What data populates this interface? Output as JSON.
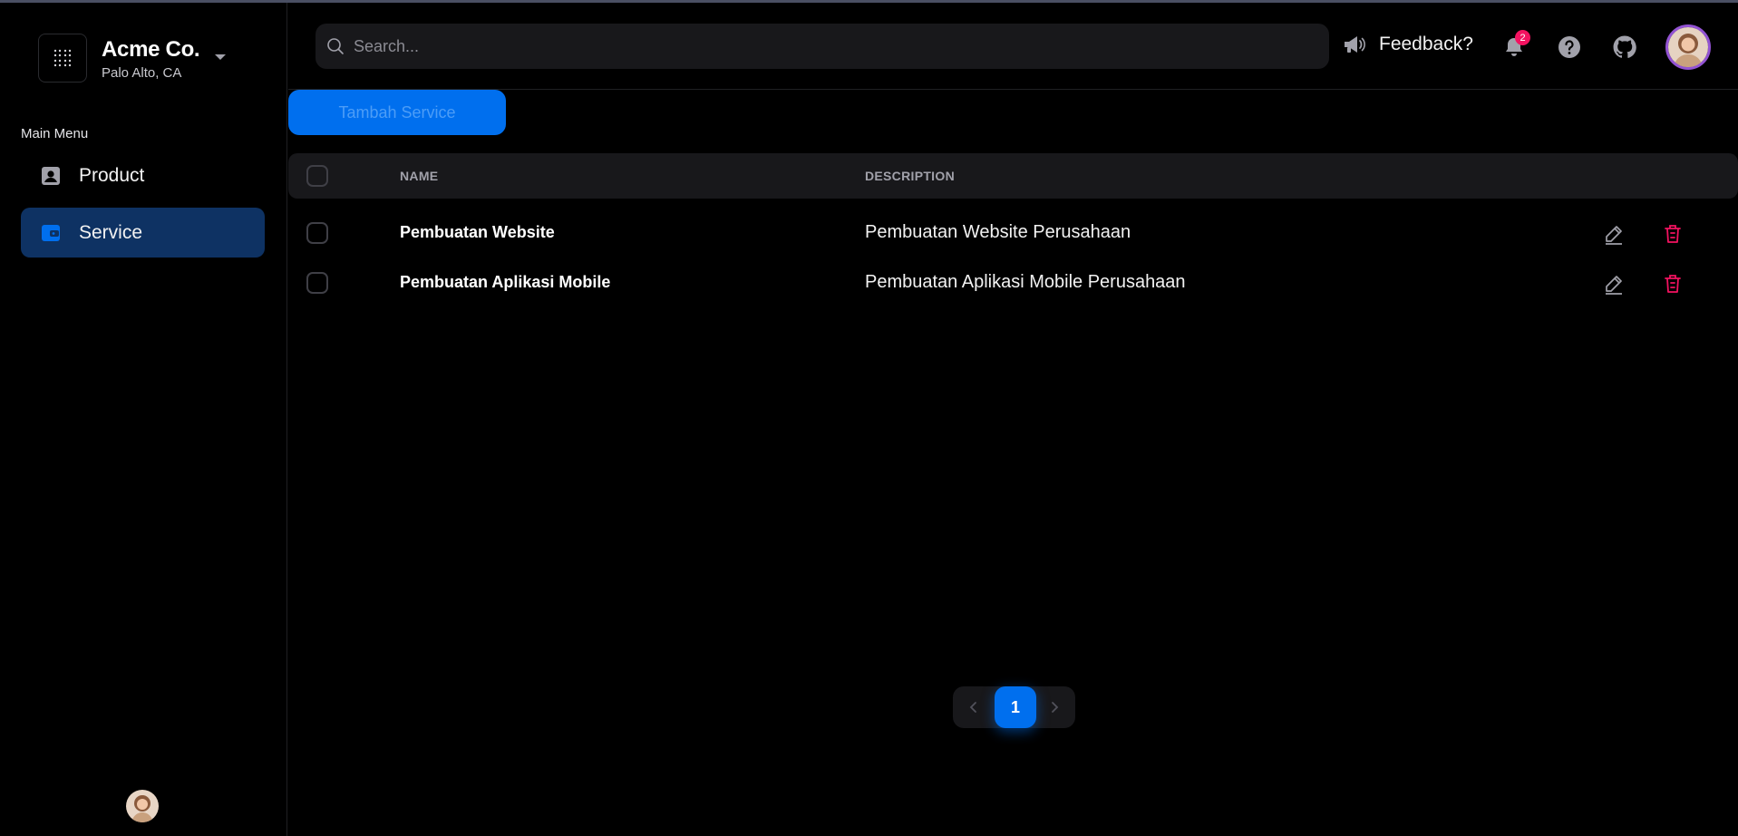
{
  "brand": {
    "name": "Acme Co.",
    "location": "Palo Alto, CA"
  },
  "sidebar": {
    "section_title": "Main Menu",
    "items": [
      {
        "label": "Product",
        "icon": "contact-card-icon",
        "active": false
      },
      {
        "label": "Service",
        "icon": "wallet-icon",
        "active": true
      }
    ]
  },
  "header": {
    "search_placeholder": "Search...",
    "feedback_label": "Feedback?",
    "notification_count": "2"
  },
  "main": {
    "add_button_label": "Tambah Service",
    "columns": [
      "NAME",
      "DESCRIPTION"
    ],
    "rows": [
      {
        "name": "Pembuatan Website",
        "description": "Pembuatan Website Perusahaan"
      },
      {
        "name": "Pembuatan Aplikasi Mobile",
        "description": "Pembuatan Aplikasi Mobile Perusahaan"
      }
    ],
    "pagination": {
      "current_page": "1"
    }
  },
  "colors": {
    "accent": "#006fee",
    "active_nav": "#0e3263",
    "danger": "#f31260",
    "surface": "#18181b",
    "avatar_ring": "#9353d3"
  }
}
